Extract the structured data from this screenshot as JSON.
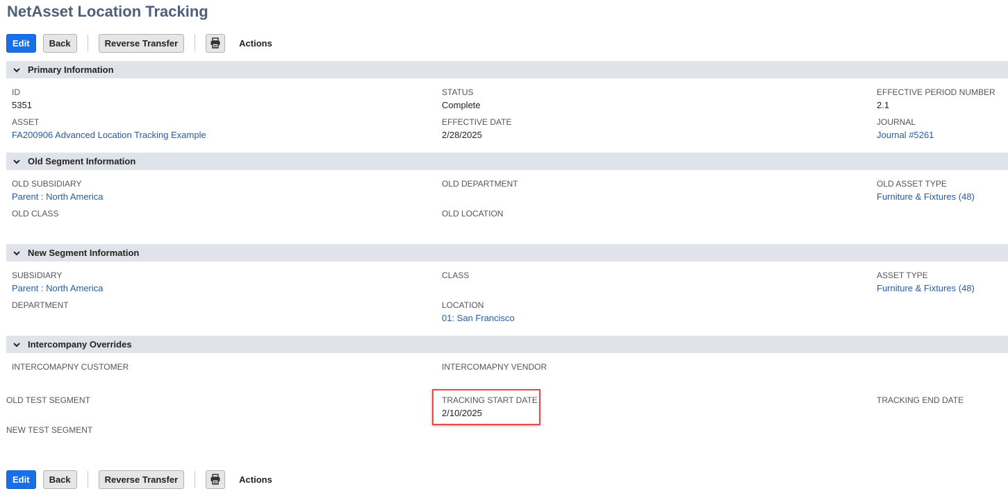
{
  "page": {
    "title": "NetAsset Location Tracking"
  },
  "toolbar": {
    "edit_label": "Edit",
    "back_label": "Back",
    "reverse_label": "Reverse Transfer",
    "actions_label": "Actions",
    "print_icon": "printer-icon"
  },
  "sections": {
    "primary": {
      "title": "Primary Information",
      "id_label": "ID",
      "id_value": "5351",
      "status_label": "STATUS",
      "status_value": "Complete",
      "period_label": "EFFECTIVE PERIOD NUMBER",
      "period_value": "2.1",
      "asset_label": "ASSET",
      "asset_value": "FA200906 Advanced Location Tracking Example",
      "effdate_label": "EFFECTIVE DATE",
      "effdate_value": "2/28/2025",
      "journal_label": "JOURNAL",
      "journal_value": "Journal #5261"
    },
    "old_segment": {
      "title": "Old Segment Information",
      "subsidiary_label": "OLD SUBSIDIARY",
      "subsidiary_value": "Parent : North America",
      "department_label": "OLD DEPARTMENT",
      "assettype_label": "OLD ASSET TYPE",
      "assettype_value": "Furniture & Fixtures (48)",
      "class_label": "OLD CLASS",
      "location_label": "OLD LOCATION"
    },
    "new_segment": {
      "title": "New Segment Information",
      "subsidiary_label": "SUBSIDIARY",
      "subsidiary_value": "Parent : North America",
      "class_label": "CLASS",
      "assettype_label": "ASSET TYPE",
      "assettype_value": "Furniture & Fixtures (48)",
      "department_label": "DEPARTMENT",
      "location_label": "LOCATION",
      "location_value": "01: San Francisco"
    },
    "intercompany": {
      "title": "Intercompany Overrides",
      "customer_label": "INTERCOMAPNY CUSTOMER",
      "vendor_label": "INTERCOMAPNY VENDOR"
    },
    "extra": {
      "old_test_label": "OLD TEST SEGMENT",
      "tracking_start_label": "TRACKING START DATE",
      "tracking_start_value": "2/10/2025",
      "tracking_end_label": "TRACKING END DATE",
      "new_test_label": "NEW TEST SEGMENT"
    }
  },
  "colors": {
    "accent": "#1870e8",
    "link": "#255ba2",
    "section_bg": "#e0e4ea",
    "title": "#4d5f79",
    "highlight": "#e34a4a"
  }
}
